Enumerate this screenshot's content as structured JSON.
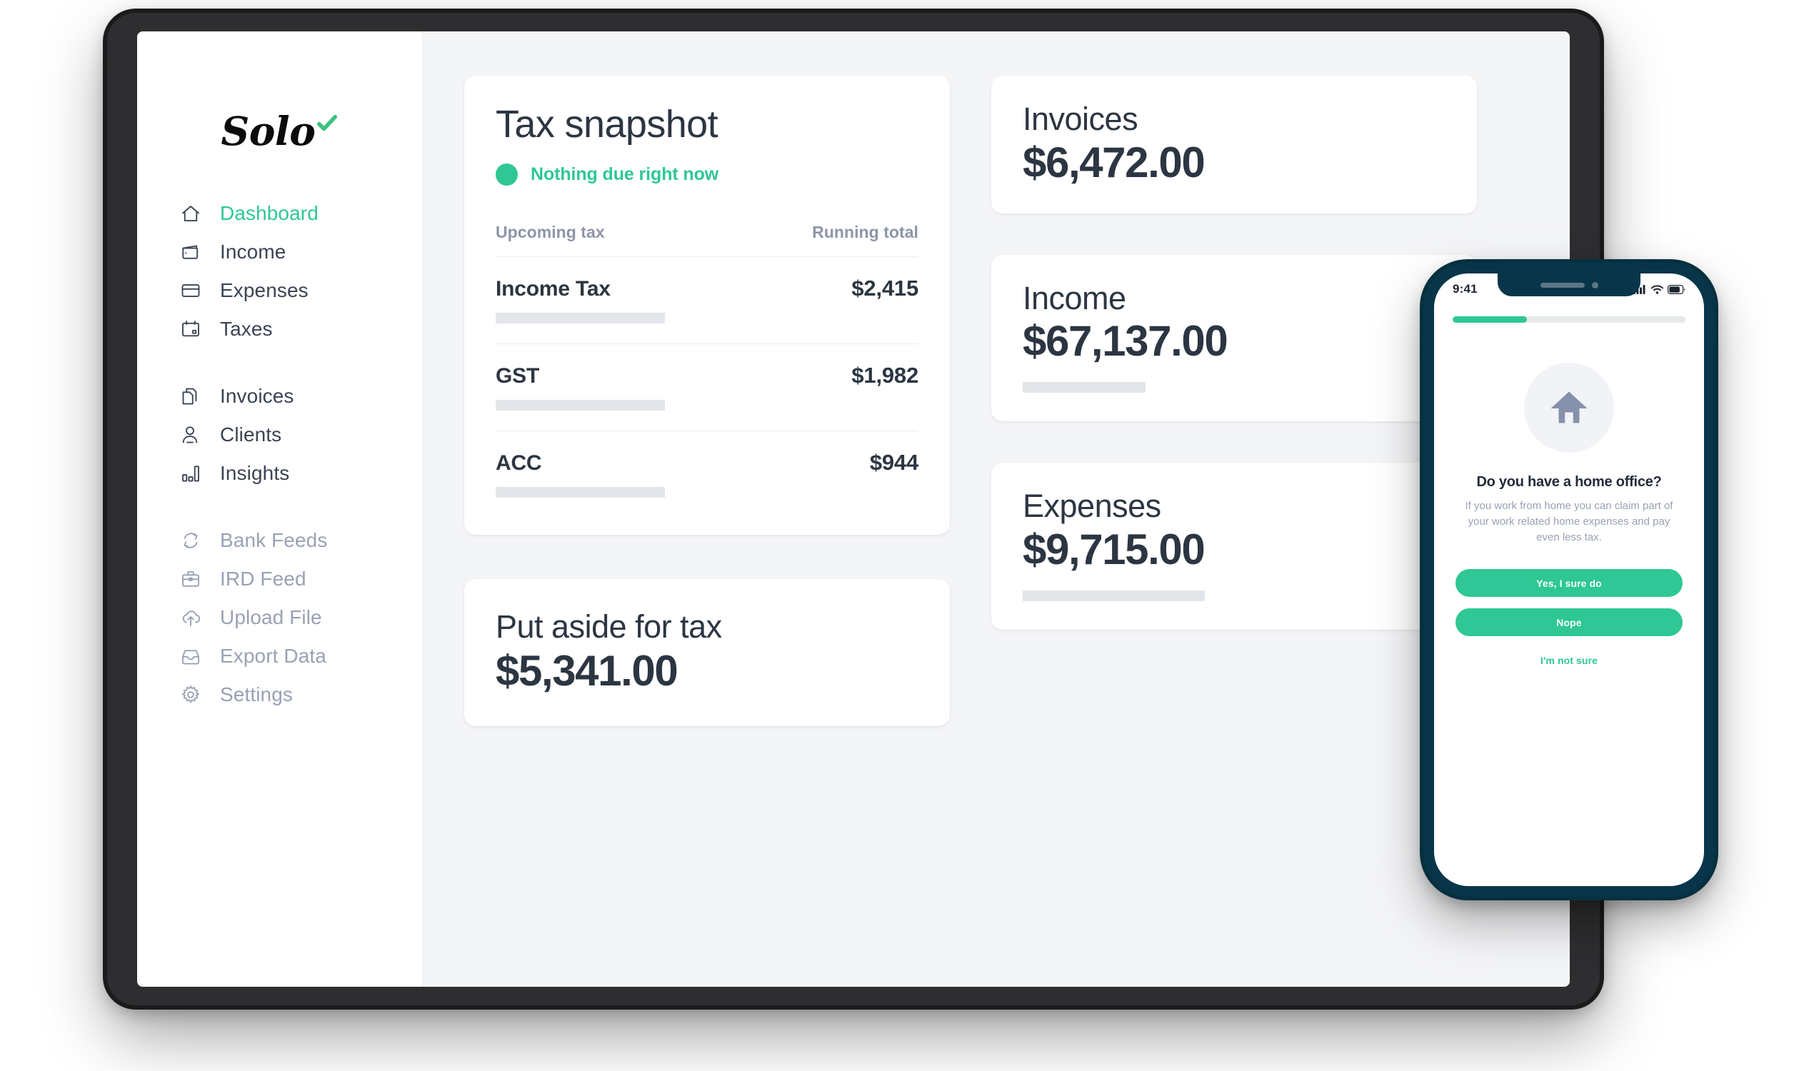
{
  "window": {
    "traffic_lights": [
      {
        "name": "close",
        "color": "#F95F57"
      },
      {
        "name": "minimize",
        "color": "#FDBC2C"
      },
      {
        "name": "zoom",
        "color": "#22C83C"
      }
    ]
  },
  "brand": {
    "name": "Solo",
    "check_icon": "check-icon",
    "accent_color": "#2EC795"
  },
  "sidebar": {
    "groups": [
      {
        "items": [
          {
            "label": "Dashboard",
            "icon": "home-icon",
            "state": "active"
          },
          {
            "label": "Income",
            "icon": "wallet-icon",
            "state": "default"
          },
          {
            "label": "Expenses",
            "icon": "credit-card-icon",
            "state": "default"
          },
          {
            "label": "Taxes",
            "icon": "calendar-icon",
            "state": "default"
          }
        ]
      },
      {
        "items": [
          {
            "label": "Invoices",
            "icon": "documents-icon",
            "state": "default"
          },
          {
            "label": "Clients",
            "icon": "users-icon",
            "state": "default"
          },
          {
            "label": "Insights",
            "icon": "bar-chart-icon",
            "state": "default"
          }
        ]
      },
      {
        "items": [
          {
            "label": "Bank Feeds",
            "icon": "sync-icon",
            "state": "muted"
          },
          {
            "label": "IRD Feed",
            "icon": "briefcase-icon",
            "state": "muted"
          },
          {
            "label": "Upload File",
            "icon": "cloud-upload-icon",
            "state": "muted"
          },
          {
            "label": "Export Data",
            "icon": "inbox-icon",
            "state": "muted"
          },
          {
            "label": "Settings",
            "icon": "gear-icon",
            "state": "muted"
          }
        ]
      }
    ]
  },
  "snapshot": {
    "title": "Tax snapshot",
    "status_text": "Nothing due right now",
    "status_color": "#2EC795",
    "column_headers": {
      "left": "Upcoming tax",
      "right": "Running total"
    },
    "rows": [
      {
        "name": "Income Tax",
        "amount": "$2,415",
        "bar_width_pct": 40
      },
      {
        "name": "GST",
        "amount": "$1,982",
        "bar_width_pct": 40
      },
      {
        "name": "ACC",
        "amount": "$944",
        "bar_width_pct": 40
      }
    ]
  },
  "put_aside": {
    "label": "Put aside for tax",
    "value": "$5,341.00"
  },
  "stats": [
    {
      "label": "Invoices",
      "value": "$6,472.00",
      "skeleton": false,
      "bar_width_pct": 0
    },
    {
      "label": "Income",
      "value": "$67,137.00",
      "skeleton": true,
      "bar_width_pct": 29
    },
    {
      "label": "Expenses",
      "value": "$9,715.00",
      "skeleton": true,
      "bar_width_pct": 43
    }
  ],
  "phone": {
    "status_time": "9:41",
    "status_icons": [
      "signal-icon",
      "wifi-icon",
      "battery-icon"
    ],
    "progress_pct": 32,
    "progress_color": "#2EC795",
    "hero_icon": "home-icon",
    "question": "Do you have a home office?",
    "subtext": "If you work from home you can claim part of your work related home expenses and pay even less tax.",
    "primary_button": "Yes, I sure do",
    "secondary_button": "Nope",
    "tertiary_link": "I'm not sure"
  }
}
